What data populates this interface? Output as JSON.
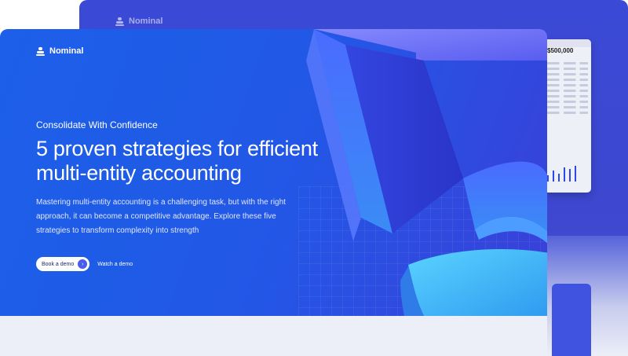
{
  "back_card": {
    "brand": "Nominal",
    "dashboard": {
      "amount": "$500,000"
    }
  },
  "hero": {
    "brand": "Nominal",
    "eyebrow": "Consolidate With Confidence",
    "headline_line1": "5 proven strategies for efficient",
    "headline_line2": "multi-entity accounting",
    "body": "Mastering multi-entity accounting is a challenging task, but with the right approach, it can become a competitive advantage. Explore these five strategies to transform complexity into strength",
    "primary_cta": "Book a demo",
    "primary_cta_icon": "arrow-right-icon",
    "secondary_cta": "Watch a demo"
  },
  "colors": {
    "hero_blue": "#1d5fe9",
    "accent_purple": "#4a5cf0",
    "art_cyan": "#39b8f5"
  }
}
